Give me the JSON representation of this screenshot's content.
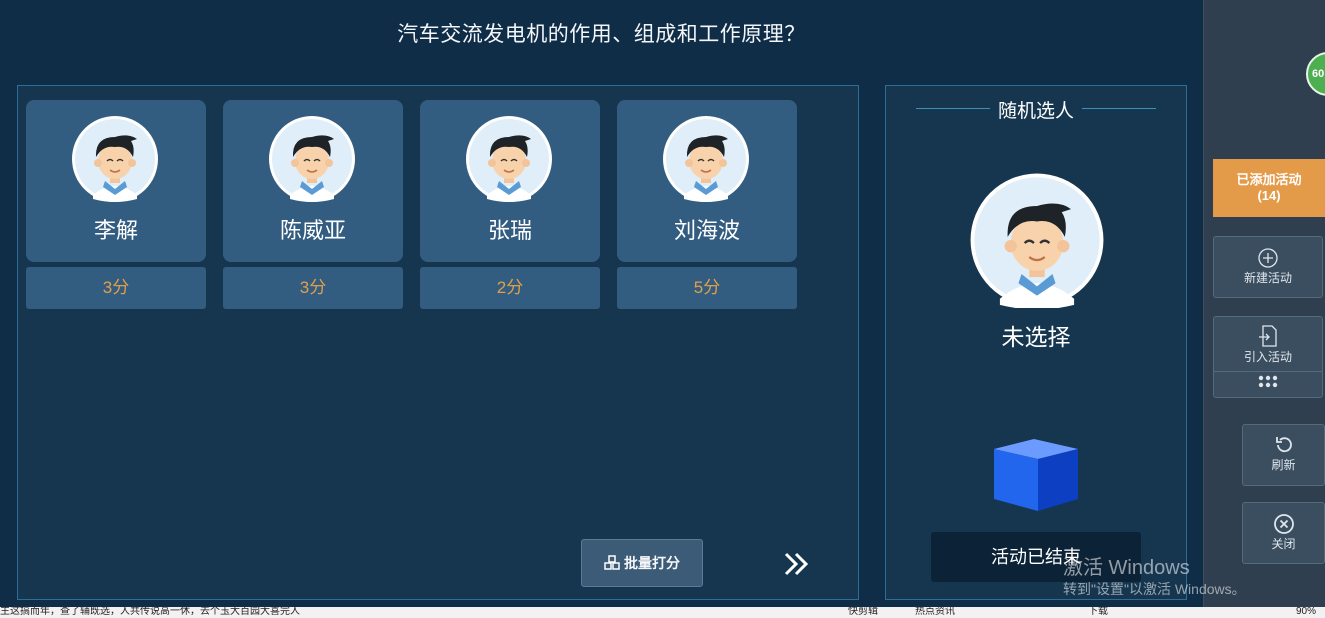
{
  "question": "汽车交流发电机的作用、组成和工作原理？",
  "students": [
    {
      "name": "李解",
      "score": "3分"
    },
    {
      "name": "陈威亚",
      "score": "3分"
    },
    {
      "name": "张瑞",
      "score": "2分"
    },
    {
      "name": "刘海波",
      "score": "5分"
    }
  ],
  "batch_score_label": "批量打分",
  "random_pick": {
    "title": "随机选人",
    "status": "未选择",
    "ended_label": "活动已结束"
  },
  "sidebar": {
    "badge": "60",
    "added_label": "已添加活动",
    "added_count": "(14)",
    "new_label": "新建活动",
    "import_label": "引入活动",
    "refresh_label": "刷新",
    "close_label": "关闭"
  },
  "watermark": {
    "line1": "激活 Windows",
    "line2": "转到\"设置\"以激活 Windows。"
  },
  "taskbar": {
    "left_text": "主这搞而年，查了辅既选，人共传说高一休，去个玉大百园大喜完人",
    "item1": "快剪辑",
    "item2": "热点资讯",
    "item3": "下载",
    "zoom": "90%"
  },
  "colors": {
    "accent_orange": "#e39b4a",
    "score_text": "#e0a04b",
    "card_bg": "#335d80",
    "panel_border": "#2e6d97"
  }
}
